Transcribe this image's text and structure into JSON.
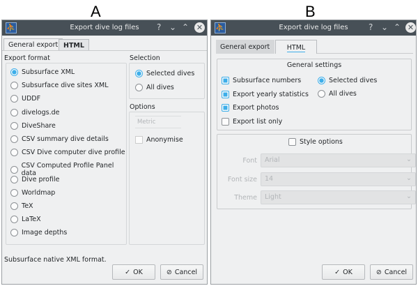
{
  "panels": {
    "a_label": "A",
    "b_label": "B"
  },
  "window": {
    "title": "Export dive log files",
    "help": "?",
    "minimize": "⌄",
    "maximize": "⌃",
    "close": "✕"
  },
  "tabs": [
    "General export",
    "HTML"
  ],
  "general": {
    "export_format_label": "Export format",
    "formats": [
      {
        "label": "Subsurface XML",
        "selected": true
      },
      {
        "label": "Subsurface dive sites XML",
        "selected": false
      },
      {
        "label": "UDDF",
        "selected": false
      },
      {
        "label": "divelogs.de",
        "selected": false
      },
      {
        "label": "DiveShare",
        "selected": false
      },
      {
        "label": "CSV summary dive details",
        "selected": false
      },
      {
        "label": "CSV Dive computer dive profile",
        "selected": false
      },
      {
        "label": "CSV Computed Profile Panel data",
        "selected": false
      },
      {
        "label": "Dive profile",
        "selected": false
      },
      {
        "label": "Worldmap",
        "selected": false
      },
      {
        "label": "TeX",
        "selected": false
      },
      {
        "label": "LaTeX",
        "selected": false
      },
      {
        "label": "Image depths",
        "selected": false
      }
    ],
    "selection_label": "Selection",
    "selection": [
      {
        "label": "Selected dives",
        "selected": true
      },
      {
        "label": "All dives",
        "selected": false
      }
    ],
    "options_label": "Options",
    "units_value": "Metric",
    "anonymise": {
      "label": "Anonymise",
      "checked": false
    },
    "status": "Subsurface native XML format."
  },
  "html": {
    "general_settings_label": "General settings",
    "checks": [
      {
        "label": "Subsurface numbers",
        "checked": true
      },
      {
        "label": "Export yearly statistics",
        "checked": true
      },
      {
        "label": "Export photos",
        "checked": true
      },
      {
        "label": "Export list only",
        "checked": false
      }
    ],
    "selection": [
      {
        "label": "Selected dives",
        "selected": true
      },
      {
        "label": "All dives",
        "selected": false
      }
    ],
    "style_options": {
      "label": "Style options",
      "checked": false
    },
    "font": {
      "label": "Font",
      "value": "Arial"
    },
    "font_size": {
      "label": "Font size",
      "value": "14"
    },
    "theme": {
      "label": "Theme",
      "value": "Light"
    }
  },
  "buttons": {
    "ok": "OK",
    "cancel": "Cancel",
    "ok_icon": "✓",
    "cancel_icon": "⊘"
  },
  "colors": {
    "accent": "#3daee9",
    "titlebar": "#475057"
  }
}
